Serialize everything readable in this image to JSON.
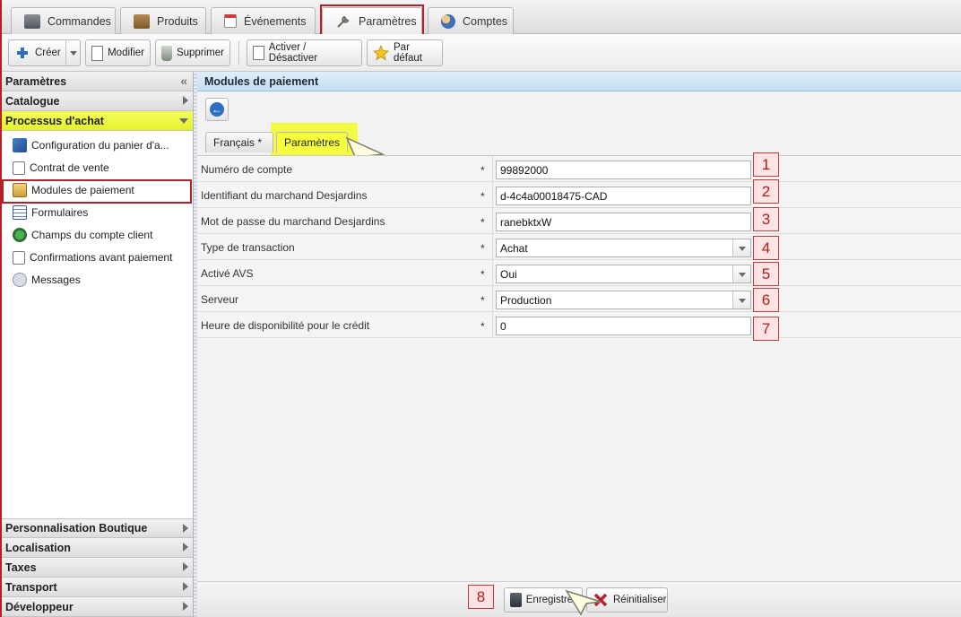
{
  "top_tabs": [
    {
      "label": "Commandes",
      "icon": "register-icon"
    },
    {
      "label": "Produits",
      "icon": "box-icon"
    },
    {
      "label": "Événements",
      "icon": "calendar-icon"
    },
    {
      "label": "Paramètres",
      "icon": "wrench-icon"
    },
    {
      "label": "Comptes",
      "icon": "users-icon"
    }
  ],
  "toolbar": {
    "create": "Créer",
    "modify": "Modifier",
    "delete": "Supprimer",
    "toggle": "Activer / Désactiver",
    "default": "Par défaut"
  },
  "sidebar": {
    "title": "Paramètres",
    "collapse_glyph": "«",
    "sections_top": [
      "Catalogue",
      "Processus d'achat"
    ],
    "items": [
      {
        "label": "Configuration du panier d'a..."
      },
      {
        "label": "Contrat de vente"
      },
      {
        "label": "Modules de paiement"
      },
      {
        "label": "Formulaires"
      },
      {
        "label": "Champs du compte client"
      },
      {
        "label": "Confirmations avant paiement"
      },
      {
        "label": "Messages"
      }
    ],
    "sections_bottom": [
      "Personnalisation Boutique",
      "Localisation",
      "Taxes",
      "Transport",
      "Développeur"
    ]
  },
  "main": {
    "title": "Modules de paiement",
    "back_glyph": "←",
    "tabs": [
      {
        "label": "Français *"
      },
      {
        "label": "Paramètres"
      }
    ],
    "required_mark": "*",
    "fields": [
      {
        "label": "Numéro de compte",
        "value": "99892000",
        "type": "text",
        "badge": "1"
      },
      {
        "label": "Identifiant du marchand Desjardins",
        "value": "d-4c4a00018475-CAD",
        "type": "text",
        "badge": "2"
      },
      {
        "label": "Mot de passe du marchand Desjardins",
        "value": "ranebktxW",
        "type": "text",
        "badge": "3"
      },
      {
        "label": "Type de transaction",
        "value": "Achat",
        "type": "select",
        "badge": "4"
      },
      {
        "label": "Activé AVS",
        "value": "Oui",
        "type": "select",
        "badge": "5"
      },
      {
        "label": "Serveur",
        "value": "Production",
        "type": "select",
        "badge": "6"
      },
      {
        "label": "Heure de disponibilité pour le crédit",
        "value": "0",
        "type": "text",
        "badge": "7"
      }
    ],
    "save": "Enregistrer",
    "reset": "Réinitialiser",
    "save_badge": "8"
  },
  "colors": {
    "highlight_yellow": "#f4ff3c",
    "highlight_red": "#b51f26",
    "header_blue": "#c6dff4",
    "badge_red": "#c23b3b"
  }
}
